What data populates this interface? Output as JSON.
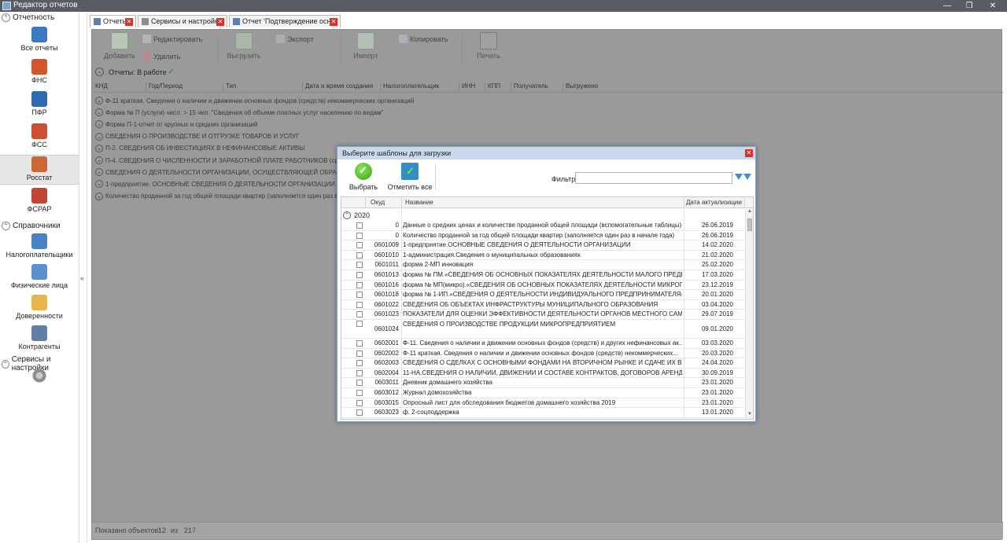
{
  "window": {
    "title": "Редактор отчетов",
    "minimize": "—",
    "maximize": "❐",
    "close": "✕"
  },
  "sidebar": {
    "reports_header": "Отчетность",
    "reports": [
      {
        "label": "Все отчеты",
        "icon": "all-reports-icon",
        "color": "#3b79c2"
      },
      {
        "label": "ФНС",
        "icon": "fns-icon",
        "color": "#d2552b"
      },
      {
        "label": "ПФР",
        "icon": "pfr-icon",
        "color": "#2f6bb2"
      },
      {
        "label": "ФСС",
        "icon": "fss-icon",
        "color": "#cf4d33"
      },
      {
        "label": "Росстат",
        "icon": "rosstat-icon",
        "color": "#c86836"
      },
      {
        "label": "ФСРАР",
        "icon": "fsrar-icon",
        "color": "#c24535"
      }
    ],
    "refs_header": "Справочники",
    "refs": [
      {
        "label": "Налогоплательщики",
        "icon": "taxpayers-icon",
        "color": "#4a80c4"
      },
      {
        "label": "Физические лица",
        "icon": "individuals-icon",
        "color": "#5a8fd0"
      },
      {
        "label": "Доверенности",
        "icon": "power-of-attorney-icon",
        "color": "#e8b64a"
      },
      {
        "label": "Контрагенты",
        "icon": "counterparties-icon",
        "color": "#5d7fa8"
      }
    ],
    "services_header": "Сервисы и настройки",
    "collapse_arrow": "«"
  },
  "tabs": [
    {
      "label": "Отчеты"
    },
    {
      "label": "Сервисы и настройки"
    },
    {
      "label": "Отчет 'Подтверждение осн...'"
    }
  ],
  "toolbar": {
    "add": "Добавить",
    "edit": "Редактировать",
    "delete": "Удалить",
    "upload": "Выгрузить",
    "export": "Экспорт",
    "import": "Импорт",
    "copy": "Копировать",
    "print": "Печать"
  },
  "group": {
    "label": "Отчеты: В работе",
    "check": "✓"
  },
  "columns": [
    "КНД",
    "Год/Период",
    "Тип",
    "Дата и время создания",
    "Налогоплательщик",
    "ИНН",
    "КПП",
    "Получатель",
    "Выгружено"
  ],
  "report_rows": [
    "Ф-11 краткая. Сведения о наличии и движении основных фондов (средств) некоммерческих организаций",
    "Форма № П (услуги) числ. > 15 чел. \"Сведения об объеме платных услуг населению по видам\"",
    "Форма П-1-отчет от крупных и средних организаций",
    "СВЕДЕНИЯ О ПРОИЗВОДСТВЕ И ОТГРУЗКЕ ТОВАРОВ И УСЛУГ",
    "П-2. СВЕДЕНИЯ ОБ ИНВЕСТИЦИЯХ В НЕФИНАНСОВЫЕ АКТИВЫ",
    "П-4. СВЕДЕНИЯ О ЧИСЛЕННОСТИ И ЗАРАБОТНОЙ ПЛАТЕ РАБОТНИКОВ (средн",
    "СВЕДЕНИЯ О ДЕЯТЕЛЬНОСТИ ОРГАНИЗАЦИИ, ОСУЩЕСТВЛЯЮЩЕЙ ОБРАЗОВА",
    "1-предприятие. ОСНОВНЫЕ СВЕДЕНИЯ О ДЕЯТЕЛЬНОСТИ ОРГАНИЗАЦИИ",
    "Количество проданной за год общей площади квартир (заполняется один раз в"
  ],
  "status": {
    "shown_label": "Показано объектов:",
    "shown": "12",
    "of_label": "из",
    "total": "217"
  },
  "dialog": {
    "title": "Выберите шаблоны для загрузки",
    "close": "✕",
    "select": "Выбрать",
    "mark_all": "Отметить все",
    "filter_label": "Фильтр:",
    "filter_value": "",
    "columns": {
      "okud": "Окуд",
      "name": "Название",
      "date": "Дата актуализации"
    },
    "year": "2020",
    "rows": [
      {
        "code": "0",
        "name": "Данные о средних ценах и количестве проданной общей площади (вспомогательные таблицы)",
        "date": "26.06.2019"
      },
      {
        "code": "0",
        "name": "Количество проданной за год общей площади квартир (заполняется один раз в начале года)",
        "date": "26.06.2019"
      },
      {
        "code": "0601009",
        "name": "1-предприятие.ОСНОВНЫЕ СВЕДЕНИЯ О ДЕЯТЕЛЬНОСТИ ОРГАНИЗАЦИИ",
        "date": "14.02.2020"
      },
      {
        "code": "0601010",
        "name": "1-администрация.Сведения о муниципальных образованиях",
        "date": "21.02.2020"
      },
      {
        "code": "0601011",
        "name": "форма 2-МП инновация",
        "date": "25.02.2020"
      },
      {
        "code": "0601013",
        "name": "форма № ПМ.«СВЕДЕНИЯ ОБ ОСНОВНЫХ ПОКАЗАТЕЛЯХ ДЕЯТЕЛЬНОСТИ МАЛОГО ПРЕДПРИ...",
        "date": "17.03.2020"
      },
      {
        "code": "0601016",
        "name": "форма № МП(микро).«СВЕДЕНИЯ ОБ ОСНОВНЫХ ПОКАЗАТЕЛЯХ ДЕЯТЕЛЬНОСТИ МИКРОПРЕ...",
        "date": "23.12.2019"
      },
      {
        "code": "0601018",
        "name": "форма № 1-ИП.«СВЕДЕНИЯ О ДЕЯТЕЛЬНОСТИ ИНДИВИДУАЛЬНОГО ПРЕДПРИНИМАТЕЛЯ»",
        "date": "20.01.2020"
      },
      {
        "code": "0601022",
        "name": "СВЕДЕНИЯ ОБ ОБЪЕКТАХ ИНФРАСТРУКТУРЫ МУНИЦИПАЛЬНОГО ОБРАЗОВАНИЯ",
        "date": "03.04.2020"
      },
      {
        "code": "0601023",
        "name": "ПОКАЗАТЕЛИ ДЛЯ ОЦЕНКИ ЭФФЕКТИВНОСТИ ДЕЯТЕЛЬНОСТИ ОРГАНОВ МЕСТНОГО САМОУ...",
        "date": "29.07.2019"
      },
      {
        "code": "0601024",
        "name": "СВЕДЕНИЯ О ПРОИЗВОДСТВЕ ПРОДУКЦИИ МИКРОПРЕДПРИЯТИЕМ",
        "date": "09.01.2020",
        "tall": true
      },
      {
        "code": "0602001",
        "name": "Ф-11. Сведения о наличии и движении основных фондов (средств) и других нефинансовых ак...",
        "date": "03.03.2020"
      },
      {
        "code": "0602002",
        "name": "Ф-11 краткая. Сведения о наличии и движении основных фондов (средств) некоммерческих...",
        "date": "20.03.2020"
      },
      {
        "code": "0602003",
        "name": "СВЕДЕНИЯ О СДЕЛКАХ С ОСНОВНЫМИ ФОНДАМИ НА ВТОРИЧНОМ РЫНКЕ  И СДАЧЕ ИХ В А...",
        "date": "24.04.2020"
      },
      {
        "code": "0602004",
        "name": "11-НА.СВЕДЕНИЯ О НАЛИЧИИ, ДВИЖЕНИИ И СОСТАВЕ КОНТРАКТОВ, ДОГОВОРОВ АРЕНДЫ...",
        "date": "30.09.2019"
      },
      {
        "code": "0603011",
        "name": "Дневник домашнего хозяйства",
        "date": "23.01.2020"
      },
      {
        "code": "0603012",
        "name": "Журнал домохозяйства",
        "date": "23.01.2020"
      },
      {
        "code": "0603015",
        "name": "Опросный лист для обследования бюджетов домашнего хозяйства 2019",
        "date": "23.01.2020"
      },
      {
        "code": "0603023",
        "name": "ф. 2-соцподдержка",
        "date": "13.01.2020"
      }
    ]
  }
}
